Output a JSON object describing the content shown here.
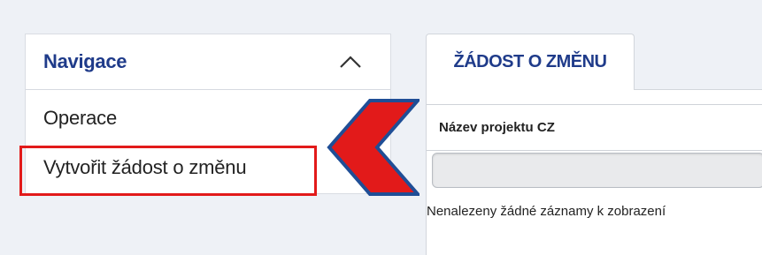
{
  "navigation": {
    "title": "Navigace",
    "toggle_icon": "chevron-up-icon",
    "items": [
      {
        "label": "Operace"
      },
      {
        "label": "Vytvořit žádost o změnu",
        "highlighted": true
      }
    ]
  },
  "tabs": [
    {
      "label": "ŽÁDOST O ZMĚNU",
      "active": true
    }
  ],
  "table": {
    "columns": [
      "Název projektu CZ"
    ],
    "filter_value": "",
    "empty_message": "Nenalezeny žádné záznamy k zobrazení"
  },
  "annotation": {
    "arrow_icon": "pointer-arrow-icon",
    "arrow_fill": "#e21a1a",
    "arrow_outline": "#1f4e96",
    "highlight_color": "#e21a1a"
  },
  "colors": {
    "accent": "#1f3b8a",
    "background": "#eef1f6"
  }
}
